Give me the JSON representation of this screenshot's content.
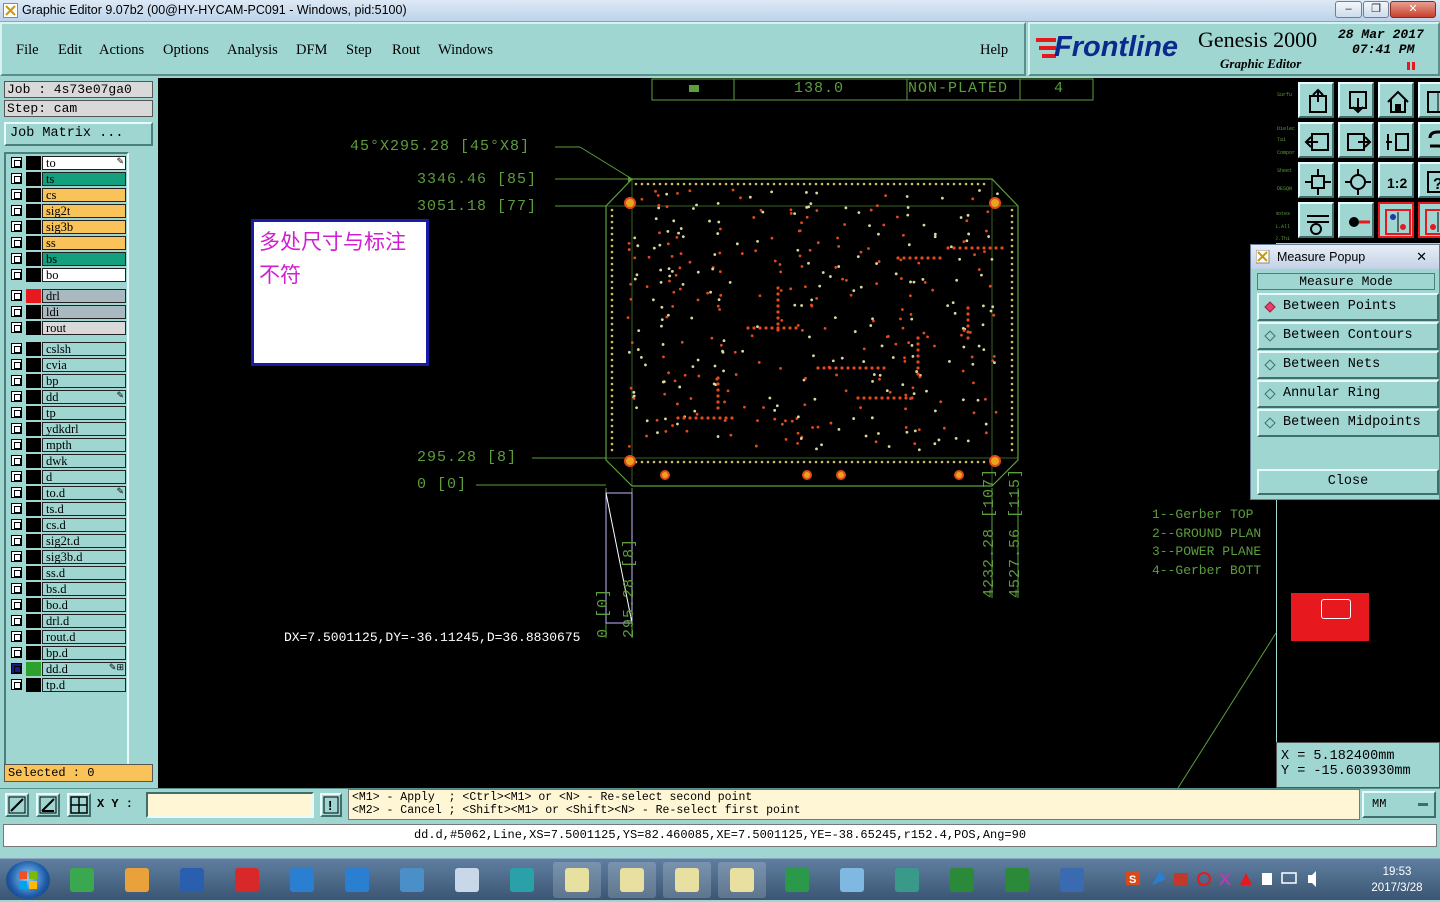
{
  "window": {
    "title": "Graphic Editor 9.07b2 (00@HY-HYCAM-PC091 - Windows, pid:5100)"
  },
  "menu": {
    "items": [
      "File",
      "Edit",
      "Actions",
      "Options",
      "Analysis",
      "DFM",
      "Step",
      "Rout",
      "Windows"
    ],
    "help": "Help"
  },
  "logo": {
    "brand": "Frontline",
    "product": "Genesis 2000",
    "subtitle": "Graphic Editor",
    "date": "28 Mar 2017",
    "time": "07:41 PM"
  },
  "job": {
    "job_label": "Job : 4s73e07ga0",
    "step_label": "Step: cam",
    "matrix_button": "Job Matrix ..."
  },
  "layers": [
    {
      "name": "to",
      "color": "#ffffff",
      "swatch": "#000000",
      "mark": "✎"
    },
    {
      "name": "ts",
      "color": "#14a07e",
      "swatch": "#000000",
      "mark": ""
    },
    {
      "name": "cs",
      "color": "#f9c359",
      "swatch": "#000000",
      "mark": ""
    },
    {
      "name": "sig2t",
      "color": "#f9c359",
      "swatch": "#000000",
      "mark": ""
    },
    {
      "name": "sig3b",
      "color": "#f9c359",
      "swatch": "#000000",
      "mark": ""
    },
    {
      "name": "ss",
      "color": "#f9c359",
      "swatch": "#000000",
      "mark": ""
    },
    {
      "name": "bs",
      "color": "#14a07e",
      "swatch": "#000000",
      "mark": ""
    },
    {
      "name": "bo",
      "color": "#ffffff",
      "swatch": "#000000",
      "mark": ""
    },
    {
      "name": "drl",
      "color": "#a9b9c0",
      "swatch": "#e8191e",
      "mark": ""
    },
    {
      "name": "ldi",
      "color": "#a9b9c0",
      "swatch": "#000000",
      "mark": ""
    },
    {
      "name": "rout",
      "color": "#d9d9d9",
      "swatch": "#000000",
      "mark": ""
    },
    {
      "name": "cslsh",
      "color": "#9fd6d2",
      "swatch": "#000000",
      "mark": ""
    },
    {
      "name": "cvia",
      "color": "#9fd6d2",
      "swatch": "#000000",
      "mark": ""
    },
    {
      "name": "bp",
      "color": "#9fd6d2",
      "swatch": "#000000",
      "mark": ""
    },
    {
      "name": "dd",
      "color": "#9fd6d2",
      "swatch": "#000000",
      "mark": "✎"
    },
    {
      "name": "tp",
      "color": "#9fd6d2",
      "swatch": "#000000",
      "mark": ""
    },
    {
      "name": "ydkdrl",
      "color": "#9fd6d2",
      "swatch": "#000000",
      "mark": ""
    },
    {
      "name": "mpth",
      "color": "#9fd6d2",
      "swatch": "#000000",
      "mark": ""
    },
    {
      "name": "dwk",
      "color": "#9fd6d2",
      "swatch": "#000000",
      "mark": ""
    },
    {
      "name": "d",
      "color": "#9fd6d2",
      "swatch": "#000000",
      "mark": ""
    },
    {
      "name": "to.d",
      "color": "#9fd6d2",
      "swatch": "#000000",
      "mark": "✎"
    },
    {
      "name": "ts.d",
      "color": "#9fd6d2",
      "swatch": "#000000",
      "mark": ""
    },
    {
      "name": "cs.d",
      "color": "#9fd6d2",
      "swatch": "#000000",
      "mark": ""
    },
    {
      "name": "sig2t.d",
      "color": "#9fd6d2",
      "swatch": "#000000",
      "mark": ""
    },
    {
      "name": "sig3b.d",
      "color": "#9fd6d2",
      "swatch": "#000000",
      "mark": ""
    },
    {
      "name": "ss.d",
      "color": "#9fd6d2",
      "swatch": "#000000",
      "mark": ""
    },
    {
      "name": "bs.d",
      "color": "#9fd6d2",
      "swatch": "#000000",
      "mark": ""
    },
    {
      "name": "bo.d",
      "color": "#9fd6d2",
      "swatch": "#000000",
      "mark": ""
    },
    {
      "name": "drl.d",
      "color": "#9fd6d2",
      "swatch": "#000000",
      "mark": ""
    },
    {
      "name": "rout.d",
      "color": "#9fd6d2",
      "swatch": "#000000",
      "mark": ""
    },
    {
      "name": "bp.d",
      "color": "#9fd6d2",
      "swatch": "#000000",
      "mark": ""
    },
    {
      "name": "dd.d",
      "color": "#9fd6d2",
      "swatch": "#2ea02e",
      "mark": "✎⊞"
    },
    {
      "name": "tp.d",
      "color": "#9fd6d2",
      "swatch": "#000000",
      "mark": ""
    }
  ],
  "selected_label": "Selected : 0",
  "canvas": {
    "table_row": {
      "size": "138.0",
      "type": "NON-PLATED",
      "count": "4"
    },
    "dim_chamfer": "45°X295.28 [45°X8]",
    "dim_1": "3346.46 [85]",
    "dim_2": "3051.18 [77]",
    "dim_3": "295.28 [8]",
    "dim_4": "0 [0]",
    "dim_v1": "0 [0]",
    "dim_v2": "295.28 [8]",
    "dim_v3": "4232.28 [107]",
    "dim_v4": "4527.56 [115]",
    "measure_readout": "DX=7.5001125,DY=-36.11245,D=36.8830675",
    "note_text": "多处尺寸与标注不符",
    "notes_list": [
      "1--Gerber TOP",
      "2--GROUND PLAN",
      "3--POWER PLANE",
      "4--Gerber BOTT"
    ]
  },
  "measure_popup": {
    "title": "Measure Popup",
    "heading": "Measure Mode",
    "options": [
      {
        "label": "Between Points",
        "active": true
      },
      {
        "label": "Between Contours",
        "active": false
      },
      {
        "label": "Between Nets",
        "active": false
      },
      {
        "label": "Annular Ring",
        "active": false
      },
      {
        "label": "Between Midpoints",
        "active": false
      }
    ],
    "close": "Close"
  },
  "coords": {
    "x": "X = 5.182400mm",
    "y": "Y = -15.603930mm"
  },
  "cmd": {
    "xy_label": "X Y :",
    "xy_value": "",
    "help_line1": "<M1> - Apply  ; <Ctrl><M1> or <N> - Re-select second point",
    "help_line2": "<M2> - Cancel ; <Shift><M1> or <Shift><N> - Re-select first point",
    "units": "MM"
  },
  "status": "dd.d,#5062,Line,XS=7.5001125,YS=82.460085,XE=7.5001125,YE=-38.65245,r152.4,POS,Ang=90",
  "taskbar": {
    "time": "19:53",
    "date": "2017/3/28"
  },
  "colors": {
    "panel": "#9fd6d2",
    "canvas": "#000000",
    "outline": "#5c9e3c",
    "pads": "#e24a1c",
    "dim_text": "#5c9e3c"
  }
}
